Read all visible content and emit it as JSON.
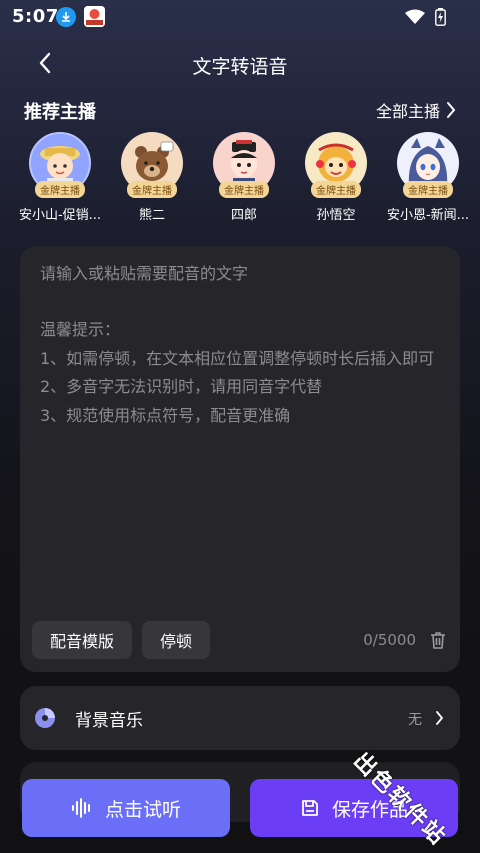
{
  "status_bar": {
    "time": "5:07"
  },
  "header": {
    "title": "文字转语音"
  },
  "anchors_section": {
    "title": "推荐主播",
    "all_label": "全部主播",
    "badge": "金牌主播",
    "items": [
      {
        "name": "安小山-促销..."
      },
      {
        "name": "熊二"
      },
      {
        "name": "四郎"
      },
      {
        "name": "孙悟空"
      },
      {
        "name": "安小恩-新闻..."
      }
    ]
  },
  "editor": {
    "placeholder": "请输入或粘贴需要配音的文字",
    "tips_title": "温馨提示：",
    "tips": [
      "1、如需停顿，在文本相应位置调整停顿时长后插入即可",
      "2、多音字无法识别时，请用同音字代替",
      "3、规范使用标点符号，配音更准确"
    ],
    "template_btn": "配音模版",
    "pause_btn": "停顿",
    "char_count": "0/5000"
  },
  "bgm": {
    "label": "背景音乐",
    "value": "无"
  },
  "actions": {
    "preview": "点击试听",
    "save": "保存作品"
  },
  "watermark": "出色软件站",
  "colors": {
    "preview": "#6b6ff7",
    "save": "#6b3ef5",
    "badge": "#f3d596"
  }
}
